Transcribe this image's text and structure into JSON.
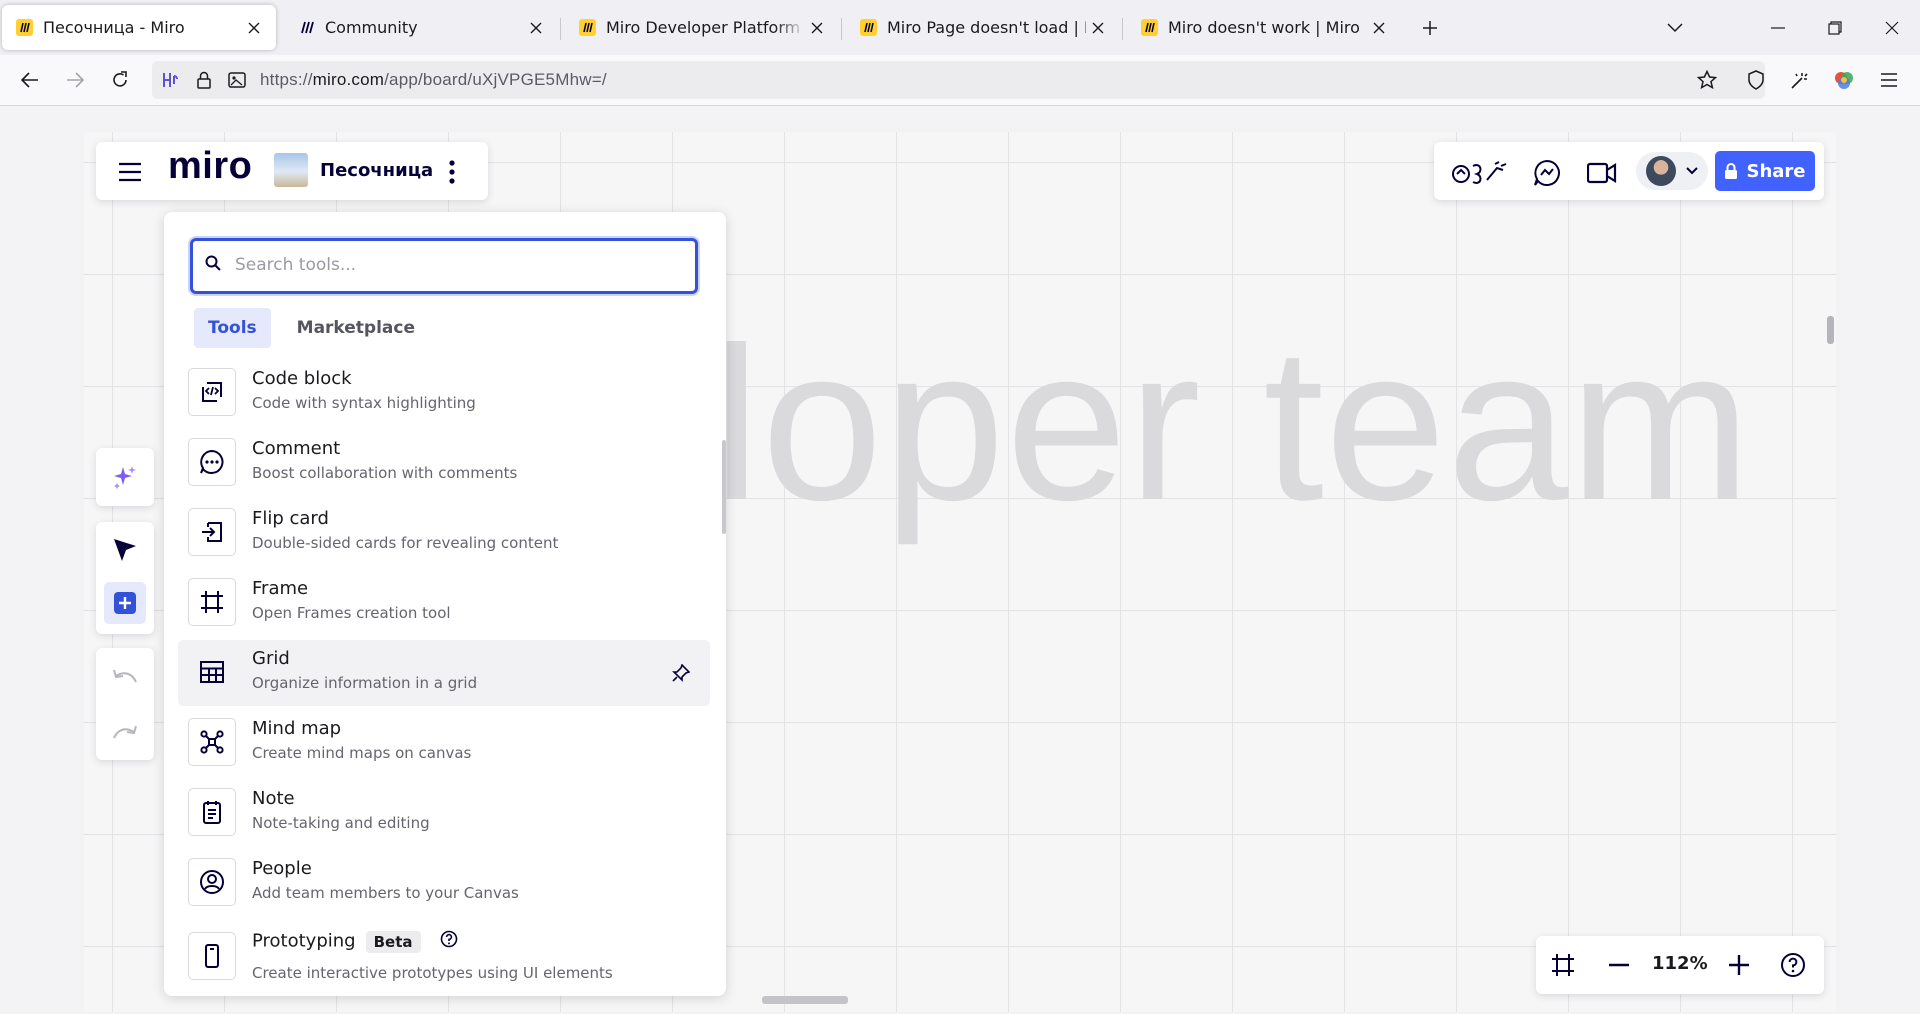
{
  "browser": {
    "tabs": [
      {
        "title": "Песочница - Miro",
        "active": true
      },
      {
        "title": "Community",
        "active": false
      },
      {
        "title": "Miro Developer Platform & API",
        "active": false
      },
      {
        "title": "Miro Page doesn't load | Miro",
        "active": false
      },
      {
        "title": "Miro doesn't work | Miro",
        "active": false
      }
    ],
    "url_prefix": "https://",
    "url_domain": "miro.com",
    "url_path": "/app/board/uXjVPGE5Mhw=/"
  },
  "board": {
    "logo": "miro",
    "name": "Песочница",
    "canvas_text": "loper team",
    "share_label": "Share",
    "zoom": "112%"
  },
  "tools_panel": {
    "search_placeholder": "Search tools...",
    "tabs": [
      {
        "label": "Tools",
        "selected": true
      },
      {
        "label": "Marketplace",
        "selected": false
      }
    ],
    "items": [
      {
        "name": "Code block",
        "desc": "Code with syntax highlighting",
        "icon": "code-block-icon"
      },
      {
        "name": "Comment",
        "desc": "Boost collaboration with comments",
        "icon": "comment-icon"
      },
      {
        "name": "Flip card",
        "desc": "Double-sided cards for revealing content",
        "icon": "flip-card-icon"
      },
      {
        "name": "Frame",
        "desc": "Open Frames creation tool",
        "icon": "frame-icon"
      },
      {
        "name": "Grid",
        "desc": "Organize information in a grid",
        "icon": "grid-icon"
      },
      {
        "name": "Mind map",
        "desc": "Create mind maps on canvas",
        "icon": "mind-map-icon"
      },
      {
        "name": "Note",
        "desc": "Note-taking and editing",
        "icon": "note-icon"
      },
      {
        "name": "People",
        "desc": "Add team members to your Canvas",
        "icon": "people-icon"
      },
      {
        "name": "Prototyping",
        "badge": "Beta",
        "desc": "Create interactive prototypes using UI elements",
        "icon": "prototyping-icon"
      }
    ]
  },
  "colors": {
    "accent": "#4262ff",
    "focus": "#3452d8",
    "favicon": "#ffd02f"
  }
}
